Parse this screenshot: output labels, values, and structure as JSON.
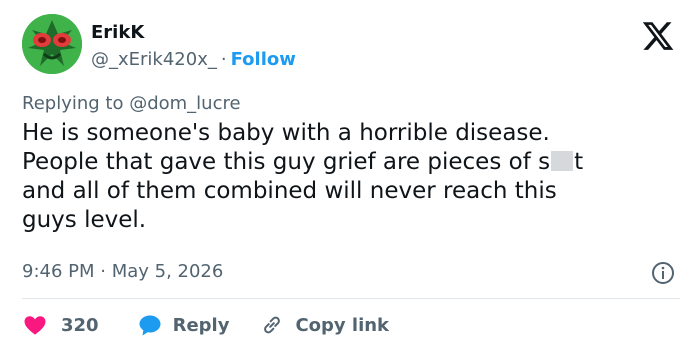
{
  "author": {
    "name": "ErikK",
    "handle": "@_xErik420x_",
    "separator": "·",
    "follow_label": "Follow"
  },
  "reply_context": "Replying to @dom_lucre",
  "tweet": {
    "line1": "He is someone's baby with a horrible disease.",
    "line2_before": "People that gave this guy grief are pieces of s",
    "line2_after": "t",
    "line3": "and all of them combined will never reach this",
    "line4": "guys level."
  },
  "timestamp": "9:46 PM · May 5, 2026",
  "actions": {
    "like_count": "320",
    "reply_label": "Reply",
    "copy_link_label": "Copy link"
  },
  "colors": {
    "accent": "#1d9bf0",
    "like": "#f91880",
    "text": "#0f1419",
    "muted": "#536471"
  },
  "icons": [
    "x-logo-icon",
    "info-icon",
    "heart-icon",
    "reply-bubble-icon",
    "link-icon"
  ]
}
